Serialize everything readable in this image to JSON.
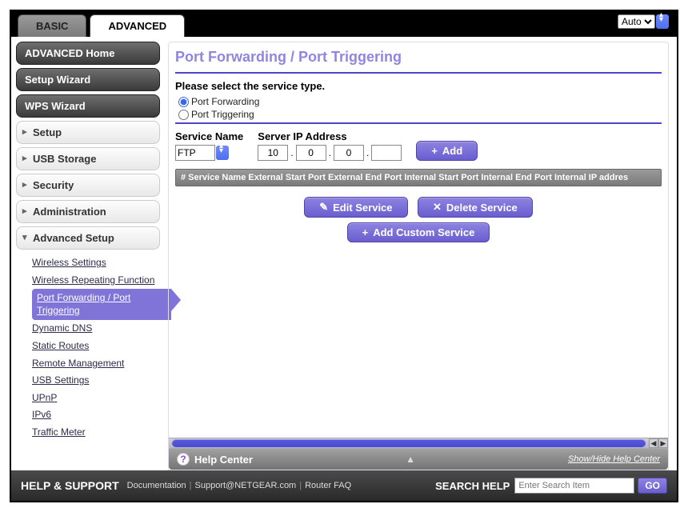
{
  "tabs": {
    "basic": "BASIC",
    "advanced": "ADVANCED"
  },
  "language": {
    "selected": "Auto"
  },
  "sidebar": {
    "home": "ADVANCED Home",
    "setup_wizard": "Setup Wizard",
    "wps_wizard": "WPS Wizard",
    "groups": {
      "setup": "Setup",
      "usb_storage": "USB Storage",
      "security": "Security",
      "administration": "Administration",
      "advanced_setup": "Advanced Setup"
    },
    "advanced_setup_items": [
      "Wireless Settings",
      "Wireless Repeating Function",
      "Port Forwarding / Port Triggering",
      "Dynamic DNS",
      "Static Routes",
      "Remote Management",
      "USB Settings",
      "UPnP",
      "IPv6",
      "Traffic Meter"
    ]
  },
  "page": {
    "title": "Port Forwarding / Port Triggering",
    "service_type_label": "Please select the service type.",
    "radio_forwarding": "Port Forwarding",
    "radio_triggering": "Port Triggering",
    "service_name_label": "Service Name",
    "service_name_value": "FTP",
    "server_ip_label": "Server IP Address",
    "ip": [
      "10",
      "0",
      "0",
      ""
    ],
    "add_button": "Add",
    "table_header": "# Service Name External Start Port External End Port Internal Start Port Internal End Port Internal IP addres",
    "edit_button": "Edit Service",
    "delete_button": "Delete Service",
    "add_custom_button": "Add Custom Service",
    "help_center": "Help Center",
    "help_toggle": "Show/Hide Help Center"
  },
  "footer": {
    "title": "HELP & SUPPORT",
    "links": [
      "Documentation",
      "Support@NETGEAR.com",
      "Router FAQ"
    ],
    "search_label": "SEARCH HELP",
    "search_placeholder": "Enter Search Item",
    "go": "GO"
  }
}
